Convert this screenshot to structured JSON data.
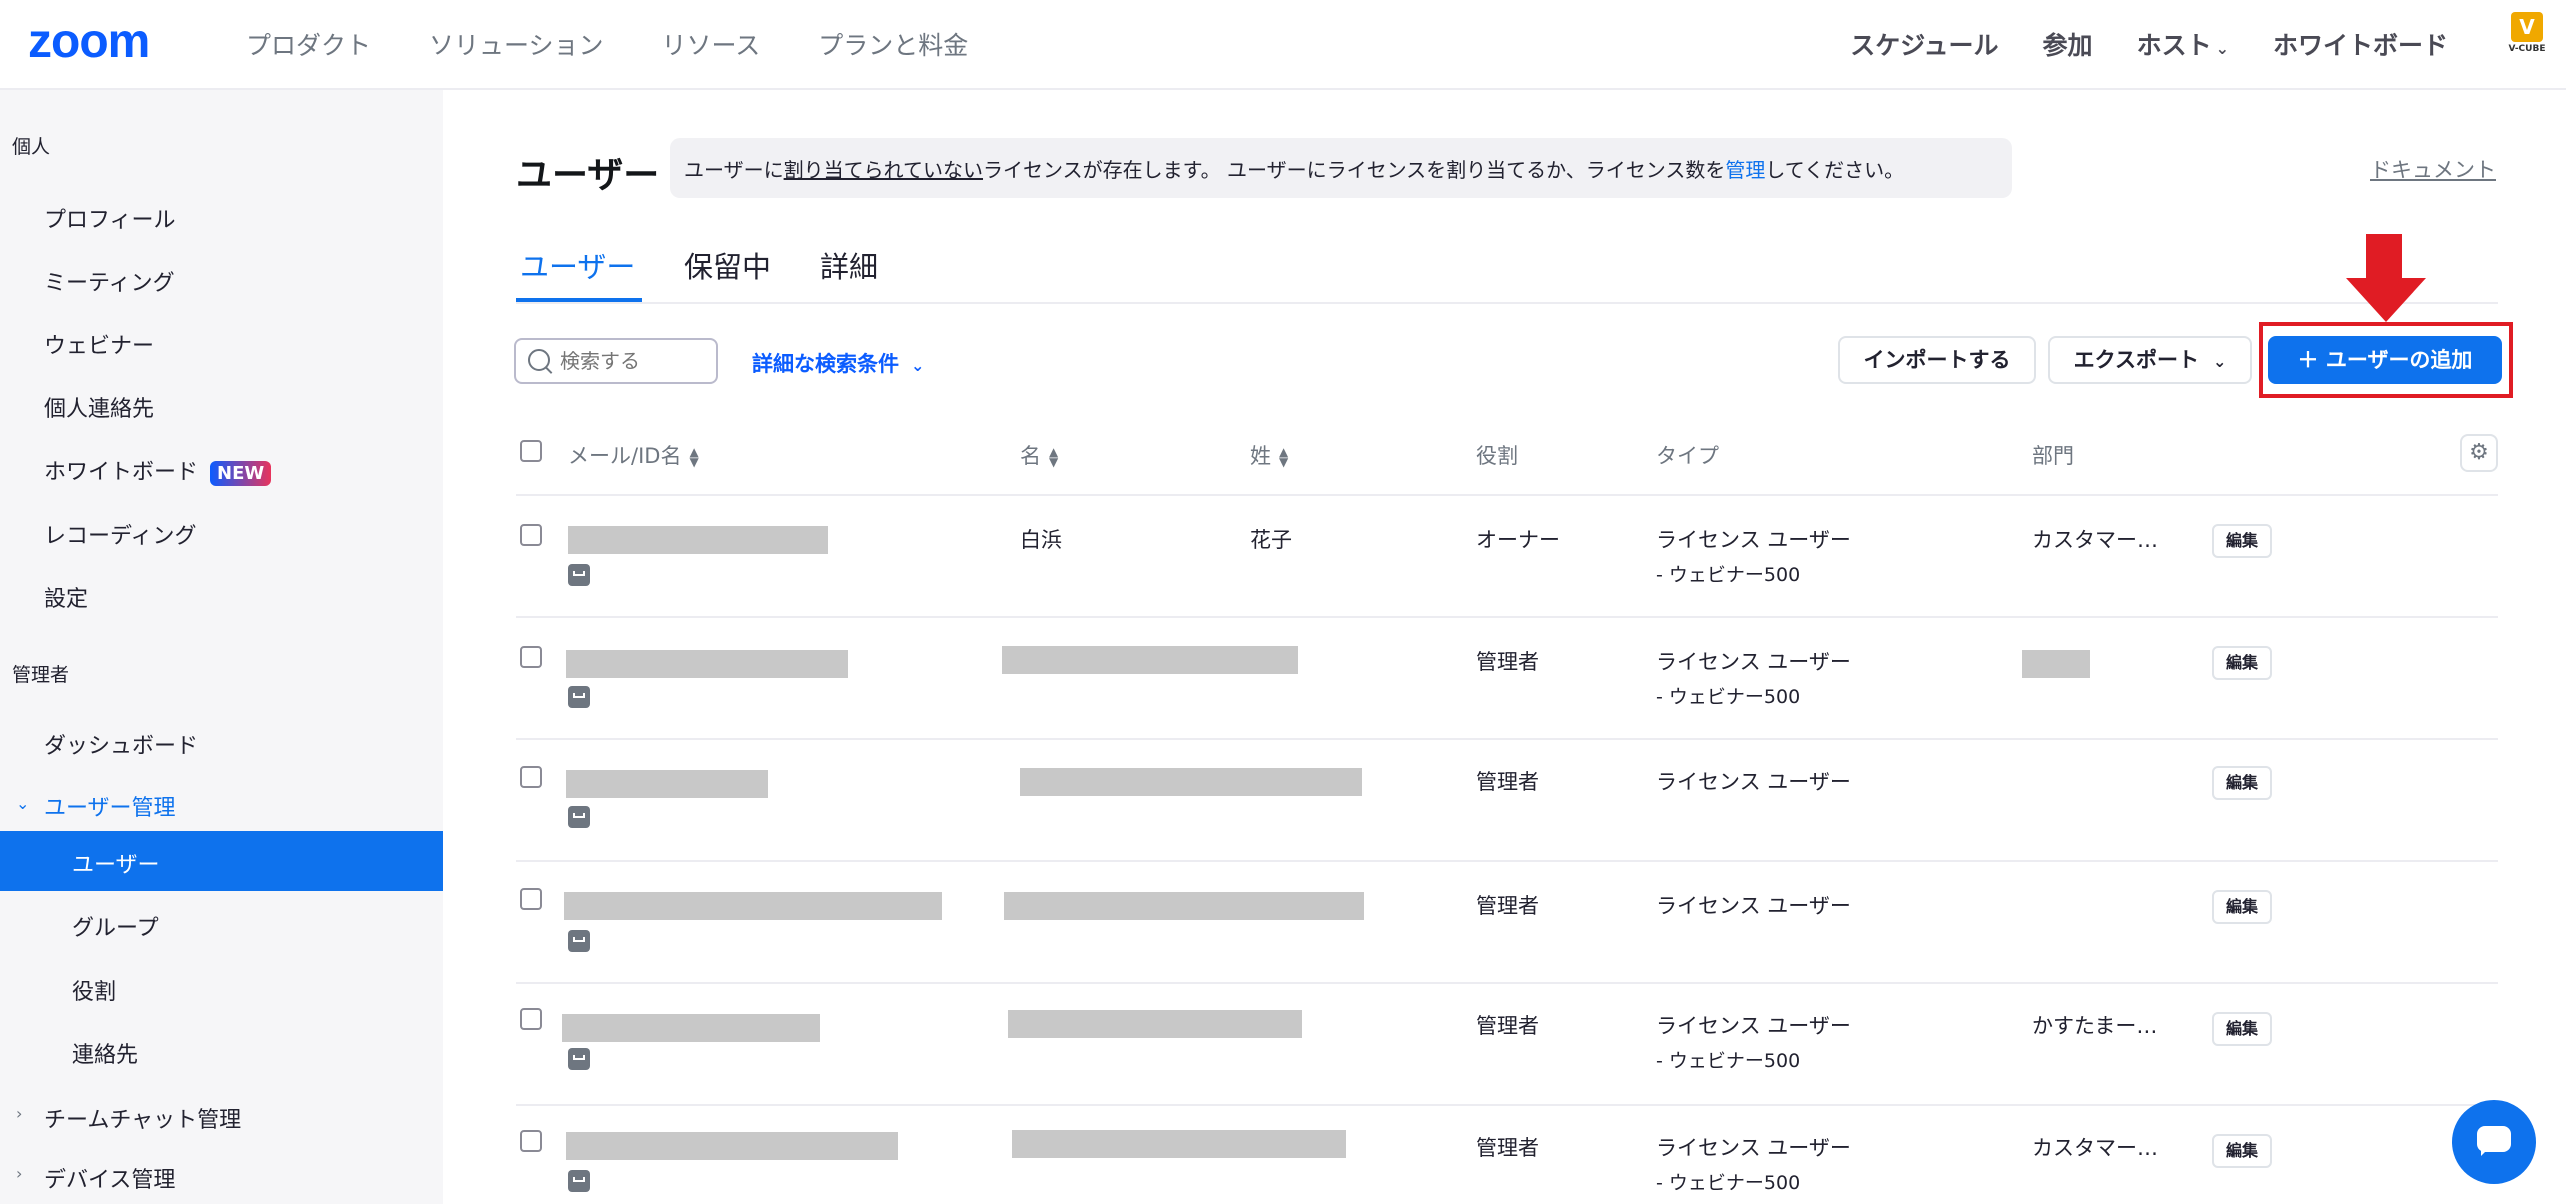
{
  "topnav": {
    "logo": "zoom",
    "left_items": [
      "プロダクト",
      "ソリューション",
      "リソース",
      "プランと料金"
    ],
    "right_items": [
      "スケジュール",
      "参加",
      "ホスト",
      "ホワイトボード"
    ],
    "host_chevron": "chevron-down-icon",
    "brand": "V-CUBE"
  },
  "sidebar": {
    "section_personal": "個人",
    "personal_items": [
      "プロフィール",
      "ミーティング",
      "ウェビナー",
      "個人連絡先",
      "ホワイトボード",
      "レコーディング",
      "設定"
    ],
    "new_badge": "NEW",
    "section_admin": "管理者",
    "dashboard": "ダッシュボード",
    "user_mgmt": "ユーザー管理",
    "user_mgmt_items": [
      "ユーザー",
      "グループ",
      "役割",
      "連絡先"
    ],
    "active_item": "ユーザー",
    "team_chat": "チームチャット管理",
    "device_mgmt": "デバイス管理"
  },
  "main": {
    "title": "ユーザー",
    "notice": {
      "part1": "ユーザーに",
      "underline": "割り当てられていない",
      "part2": "ライセンスが存在します。 ユーザーにライセンスを割り当てるか、ライセンス数を",
      "link": "管理",
      "part3": "してください。"
    },
    "doc_link": "ドキュメント",
    "tabs": [
      "ユーザー",
      "保留中",
      "詳細"
    ],
    "active_tab": "ユーザー",
    "search_placeholder": "検索する",
    "advanced_search": "詳細な検索条件",
    "import_button": "インポートする",
    "export_button": "エクスポート",
    "add_button": "＋ ユーザーの追加"
  },
  "table": {
    "headers": {
      "email": "メール/ID名",
      "first": "名",
      "last": "姓",
      "role": "役割",
      "type": "タイプ",
      "dept": "部門"
    },
    "edit_label": "編集",
    "rows": [
      {
        "first": "白浜",
        "last": "花子",
        "role": "オーナー",
        "type": "ライセンス ユーザー",
        "type_sub": "- ウェビナー500",
        "dept": "カスタマー…"
      },
      {
        "first": "",
        "last": "",
        "role": "管理者",
        "type": "ライセンス ユーザー",
        "type_sub": "- ウェビナー500",
        "dept": ""
      },
      {
        "first": "",
        "last": "",
        "role": "管理者",
        "type": "ライセンス ユーザー",
        "type_sub": "",
        "dept": ""
      },
      {
        "first": "",
        "last": "",
        "role": "管理者",
        "type": "ライセンス ユーザー",
        "type_sub": "",
        "dept": ""
      },
      {
        "first": "",
        "last": "",
        "role": "管理者",
        "type": "ライセンス ユーザー",
        "type_sub": "- ウェビナー500",
        "dept": "かすたまー…"
      },
      {
        "first": "",
        "last": "",
        "role": "管理者",
        "type": "ライセンス ユーザー",
        "type_sub": "- ウェビナー500",
        "dept": "カスタマー…"
      }
    ]
  },
  "colors": {
    "brand_blue": "#0e72ed",
    "highlight_red": "#e01c24"
  }
}
